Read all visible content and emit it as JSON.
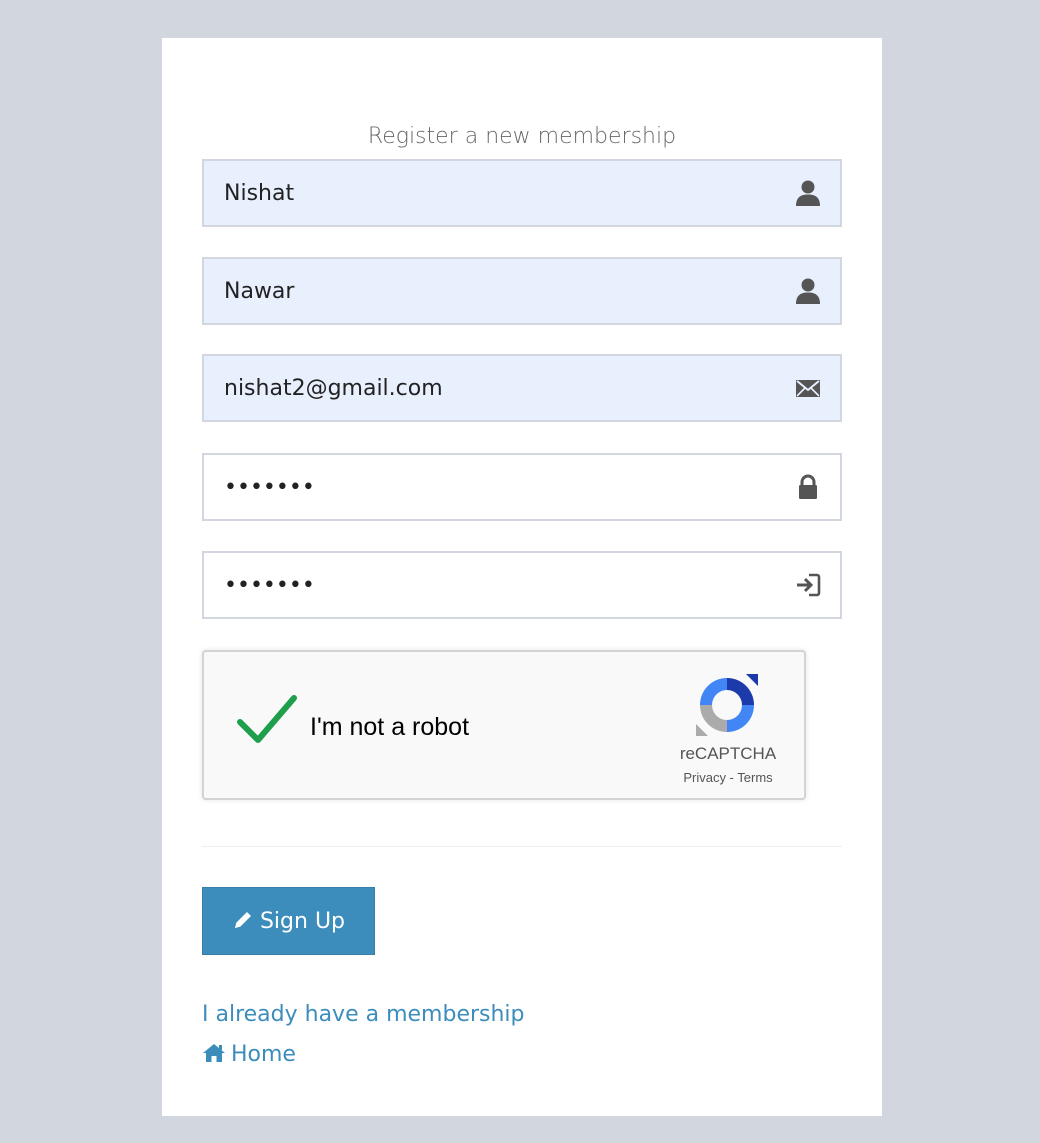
{
  "page": {
    "title": "Register a new membership"
  },
  "form": {
    "first_name": "Nishat",
    "last_name": "Nawar",
    "email": "nishat2@gmail.com",
    "password": "•••••••",
    "confirm_password": "•••••••"
  },
  "captcha": {
    "label": "I'm not a robot",
    "brand": "reCAPTCHA",
    "links": "Privacy - Terms",
    "checked": true
  },
  "actions": {
    "signup_label": "Sign Up",
    "membership_link": "I already have a membership",
    "home_link": "Home"
  },
  "icons": {
    "first_name": "user-icon",
    "last_name": "user-icon",
    "email": "envelope-icon",
    "password": "lock-icon",
    "confirm_password": "log-in-icon",
    "signup": "pencil-icon",
    "home": "home-icon"
  },
  "colors": {
    "background": "#d2d6de",
    "accent": "#3c8dbc",
    "filled_input": "#e8f0fe",
    "check": "#1f9e4c"
  }
}
